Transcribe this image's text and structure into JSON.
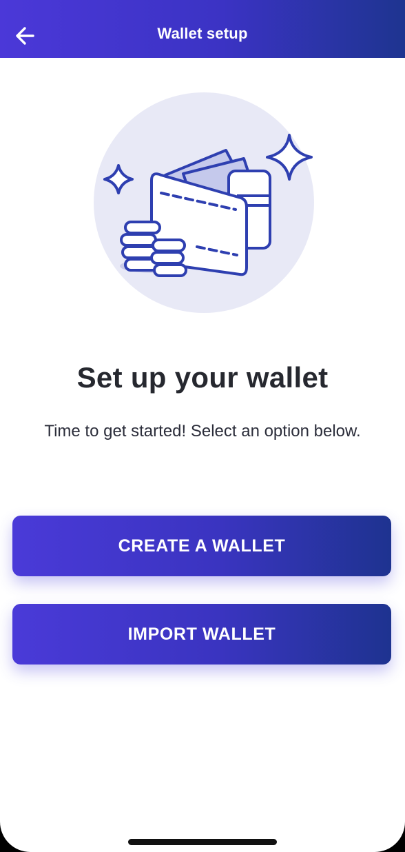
{
  "header": {
    "title": "Wallet setup",
    "back_icon": "arrow-left-icon"
  },
  "illustration": {
    "icon": "wallet-coins-illustration",
    "colors": {
      "circle": "#e8e9f6",
      "stroke": "#2e3fb0",
      "card": "#c5c9ec"
    }
  },
  "main": {
    "title": "Set up your wallet",
    "subtitle": "Time to get started! Select an option below."
  },
  "actions": {
    "create_label": "CREATE A WALLET",
    "import_label": "IMPORT WALLET"
  },
  "colors": {
    "gradient_start": "#4b38d8",
    "gradient_end": "#1e3490",
    "title_text": "#26282f"
  }
}
